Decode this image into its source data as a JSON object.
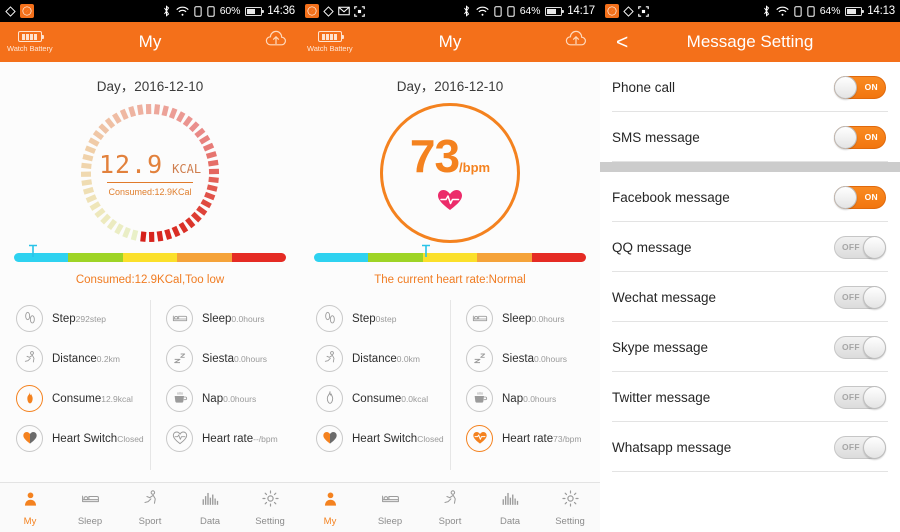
{
  "panels": [
    {
      "id": "my-daily-calories",
      "statusbar": {
        "battery_pct": "60%",
        "time": "14:36",
        "icons": [
          "diamond-icon",
          "compass-app-icon",
          "bluetooth-icon",
          "wifi-icon",
          "sim1-icon",
          "sim2-icon",
          "battery-icon"
        ]
      },
      "header": {
        "title": "My",
        "watch_battery_label": "Watch Battery",
        "upload_icon": "cloud-upload-icon"
      },
      "date": "Day，2016-12-10",
      "dial": {
        "value": "12.9",
        "unit": "KCAL",
        "subtitle": "Consumed:12.9KCal",
        "progress_pct": 62
      },
      "bar": {
        "marker_pct": 7,
        "note": "Consumed:12.9KCal,Too low",
        "colors": [
          "#2ed2f0",
          "#9ed426",
          "#fbe02b",
          "#f5a33a",
          "#e52b24"
        ]
      },
      "stats_left": [
        {
          "icon": "footprint-icon",
          "label": "Step",
          "value": "292step",
          "active": false
        },
        {
          "icon": "runner-icon",
          "label": "Distance",
          "value": "0.2km",
          "active": false
        },
        {
          "icon": "flame-icon",
          "label": "Consume",
          "value": "12.9kcal",
          "active": true
        },
        {
          "icon": "heart-icon",
          "label": "Heart Switch",
          "value": "Closed",
          "active": false
        }
      ],
      "stats_right": [
        {
          "icon": "bed-icon",
          "label": "Sleep",
          "value": "0.0hours",
          "active": false
        },
        {
          "icon": "zzz-icon",
          "label": "Siesta",
          "value": "0.0hours",
          "active": false
        },
        {
          "icon": "coffee-icon",
          "label": "Nap",
          "value": "0.0hours",
          "active": false
        },
        {
          "icon": "heart-pulse-icon",
          "label": "Heart rate",
          "value": "--/bpm",
          "active": false
        }
      ],
      "tabs": [
        {
          "icon": "person-icon",
          "label": "My",
          "active": true
        },
        {
          "icon": "bed-icon",
          "label": "Sleep",
          "active": false
        },
        {
          "icon": "runner-icon",
          "label": "Sport",
          "active": false
        },
        {
          "icon": "bars-icon",
          "label": "Data",
          "active": false
        },
        {
          "icon": "gear-icon",
          "label": "Setting",
          "active": false
        }
      ]
    },
    {
      "id": "my-heart-rate",
      "statusbar": {
        "battery_pct": "64%",
        "time": "14:17",
        "icons": [
          "compass-app-icon",
          "diamond-icon",
          "mail-icon",
          "scan-icon",
          "bluetooth-icon",
          "wifi-icon",
          "sim1-icon",
          "sim2-icon",
          "battery-icon"
        ]
      },
      "header": {
        "title": "My",
        "watch_battery_label": "Watch Battery",
        "upload_icon": "cloud-upload-icon"
      },
      "date": "Day，2016-12-10",
      "heart": {
        "value": "73",
        "unit": "/bpm",
        "icon": "heart-pulse-icon"
      },
      "bar": {
        "marker_pct": 41,
        "note": "The current heart rate:Normal",
        "colors": [
          "#2ed2f0",
          "#9ed426",
          "#fbe02b",
          "#f5a33a",
          "#e52b24"
        ]
      },
      "stats_left": [
        {
          "icon": "footprint-icon",
          "label": "Step",
          "value": "0step",
          "active": false
        },
        {
          "icon": "runner-icon",
          "label": "Distance",
          "value": "0.0km",
          "active": false
        },
        {
          "icon": "flame-icon",
          "label": "Consume",
          "value": "0.0kcal",
          "active": false
        },
        {
          "icon": "heart-icon",
          "label": "Heart Switch",
          "value": "Closed",
          "active": false
        }
      ],
      "stats_right": [
        {
          "icon": "bed-icon",
          "label": "Sleep",
          "value": "0.0hours",
          "active": false
        },
        {
          "icon": "zzz-icon",
          "label": "Siesta",
          "value": "0.0hours",
          "active": false
        },
        {
          "icon": "coffee-icon",
          "label": "Nap",
          "value": "0.0hours",
          "active": false
        },
        {
          "icon": "heart-pulse-icon",
          "label": "Heart rate",
          "value": "73/bpm",
          "active": true
        }
      ],
      "tabs": [
        {
          "icon": "person-icon",
          "label": "My",
          "active": true
        },
        {
          "icon": "bed-icon",
          "label": "Sleep",
          "active": false
        },
        {
          "icon": "runner-icon",
          "label": "Sport",
          "active": false
        },
        {
          "icon": "bars-icon",
          "label": "Data",
          "active": false
        },
        {
          "icon": "gear-icon",
          "label": "Setting",
          "active": false
        }
      ]
    },
    {
      "id": "message-setting",
      "statusbar": {
        "battery_pct": "64%",
        "time": "14:13",
        "icons": [
          "compass-app-icon",
          "diamond-icon",
          "scan-icon",
          "bluetooth-icon",
          "wifi-icon",
          "sim1-icon",
          "sim2-icon",
          "battery-icon"
        ]
      },
      "header": {
        "title": "Message Setting",
        "back_icon": "chevron-left-icon",
        "back_label": "<"
      },
      "settings": [
        {
          "label": "Phone call",
          "state": "ON"
        },
        {
          "label": "SMS message",
          "state": "ON"
        },
        {
          "label": "Facebook message",
          "state": "ON"
        },
        {
          "label": "QQ message",
          "state": "OFF"
        },
        {
          "label": "Wechat message",
          "state": "OFF"
        },
        {
          "label": "Skype message",
          "state": "OFF"
        },
        {
          "label": "Twitter message",
          "state": "OFF"
        },
        {
          "label": "Whatsapp message",
          "state": "OFF"
        }
      ],
      "gap_after_index": 1
    }
  ],
  "theme": {
    "accent": "#f4701a",
    "accent_light": "#f4821f",
    "text_dark": "#2e2e2e",
    "text_muted": "#9a9a9a",
    "divider": "#e3e3e3",
    "band": "#cccccc",
    "heart_pink": "#ec2c6a"
  }
}
